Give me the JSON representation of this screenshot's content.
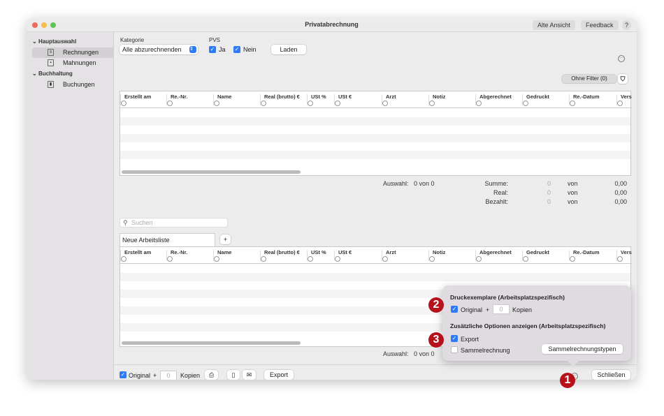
{
  "window": {
    "title": "Privatabrechnung",
    "buttons": {
      "alte_ansicht": "Alte Ansicht",
      "feedback": "Feedback",
      "help": "?"
    }
  },
  "sidebar": {
    "groups": [
      {
        "label": "Hauptauswahl",
        "items": [
          {
            "label": "Rechnungen",
            "selected": true
          },
          {
            "label": "Mahnungen"
          }
        ]
      },
      {
        "label": "Buchhaltung",
        "items": [
          {
            "label": "Buchungen"
          }
        ]
      }
    ]
  },
  "filters": {
    "kategorie_label": "Kategorie",
    "kategorie_value": "Alle abzurechnenden",
    "pvs_label": "PVS",
    "ja": "Ja",
    "nein": "Nein",
    "laden": "Laden",
    "ohne_filter": "Ohne Filter (0)"
  },
  "columns": [
    "Erstellt am",
    "Re.-Nr.",
    "Name",
    "Real (brutto) €",
    "USt %",
    "USt €",
    "Arzt",
    "Notiz",
    "Abgerechnet",
    "Gedruckt",
    "Re.-Datum",
    "Vers"
  ],
  "summary": {
    "auswahl_label": "Auswahl:",
    "auswahl_value": "0 von 0",
    "rows": [
      {
        "label": "Summe:",
        "count": "0",
        "von": "von",
        "value": "0,00"
      },
      {
        "label": "Real:",
        "count": "0",
        "von": "von",
        "value": "0,00"
      },
      {
        "label": "Bezahlt:",
        "count": "0",
        "von": "von",
        "value": "0,00"
      }
    ]
  },
  "search": {
    "placeholder": "Suchen"
  },
  "worklist": {
    "tab": "Neue Arbeitsliste",
    "add": "+",
    "auswahl_value": "0 von 0"
  },
  "footer": {
    "original": "Original",
    "plus": "+",
    "copies": "0",
    "kopien": "Kopien",
    "export": "Export",
    "schliessen": "Schließen"
  },
  "popover": {
    "heading1": "Druckexemplare (Arbeitsplatzspezifisch)",
    "original": "Original",
    "plus": "+",
    "copies": "0",
    "kopien": "Kopien",
    "heading2": "Zusätzliche Optionen anzeigen (Arbeitsplatzspezifisch)",
    "export": "Export",
    "export_checked": true,
    "sammel": "Sammelrechnung",
    "sammel_checked": false,
    "sammeltypen": "Sammelrechnungstypen"
  },
  "badges": [
    "1",
    "2",
    "3"
  ],
  "colors": {
    "accent": "#2f7bf6",
    "badge": "#b5121b"
  }
}
